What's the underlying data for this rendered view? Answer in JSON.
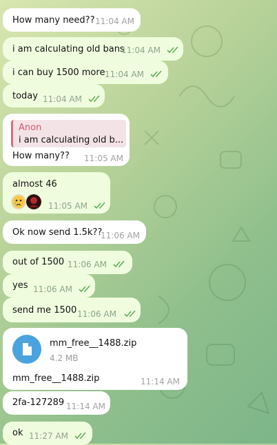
{
  "messages": [
    {
      "side": "in",
      "text": "How many need??",
      "time": "11:04 AM"
    },
    {
      "side": "out",
      "text": "i am calculating old bans",
      "time": "11:04 AM"
    },
    {
      "side": "out",
      "text": "i can buy 1500 more",
      "time": "11:04 AM"
    },
    {
      "side": "out",
      "text": "today",
      "time": "11:04 AM"
    },
    {
      "side": "in",
      "text": "How many??",
      "time": "11:05 AM",
      "reply": {
        "name": "Anon",
        "text": "i am calculating old b..."
      }
    },
    {
      "side": "out",
      "text": "almost 46",
      "time": "11:05 AM",
      "reactions": [
        "crying-emoji",
        "user-avatar"
      ]
    },
    {
      "side": "in",
      "text": "Ok now send 1.5k??",
      "time": "11:06 AM"
    },
    {
      "side": "out",
      "text": "out of 1500",
      "time": "11:06 AM"
    },
    {
      "side": "out",
      "text": "yes",
      "time": "11:06 AM"
    },
    {
      "side": "out",
      "text": "send me 1500",
      "time": "11:06 AM"
    },
    {
      "side": "in",
      "text": "mm_free__1488.zip",
      "time": "11:14 AM",
      "file": {
        "name": "mm_free__1488.zip",
        "size": "4.2 MB",
        "icon": "file-icon"
      }
    },
    {
      "side": "in",
      "text": "2fa-127289",
      "time": "11:14 AM"
    },
    {
      "side": "out",
      "text": "ok",
      "time": "11:27 AM"
    }
  ],
  "colors": {
    "incoming": "#ffffff",
    "outgoing": "#effdde",
    "reply_accent": "#d0566d",
    "file_icon": "#4aa3df",
    "check": "#5fae5a"
  }
}
